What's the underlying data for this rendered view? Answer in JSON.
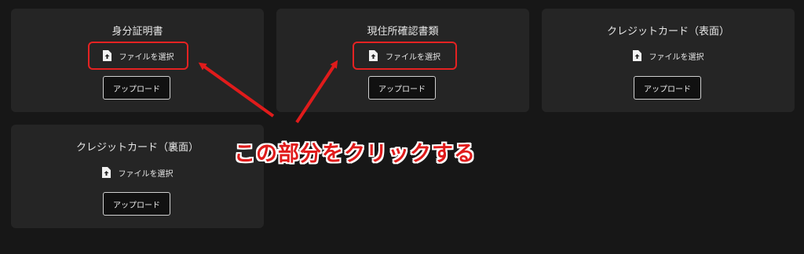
{
  "cards": [
    {
      "title": "身分証明書",
      "file_label": "ファイルを選択",
      "upload_label": "アップロード"
    },
    {
      "title": "現住所確認書類",
      "file_label": "ファイルを選択",
      "upload_label": "アップロード"
    },
    {
      "title": "クレジットカード（表面）",
      "file_label": "ファイルを選択",
      "upload_label": "アップロード"
    },
    {
      "title": "クレジットカード（裏面）",
      "file_label": "ファイルを選択",
      "upload_label": "アップロード"
    }
  ],
  "annotation": {
    "text": "この部分をクリックする",
    "color": "#e01b1b"
  },
  "icons": {
    "file": "file-upload-icon"
  }
}
